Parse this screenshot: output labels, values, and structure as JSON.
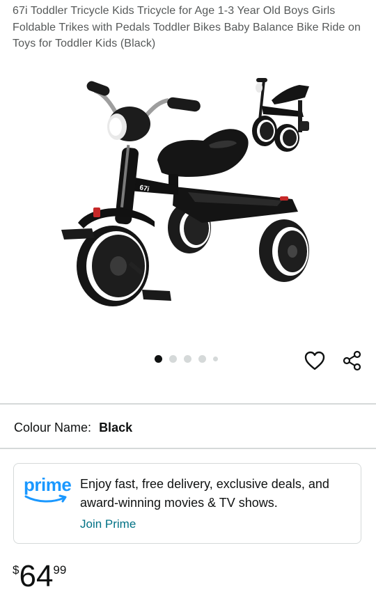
{
  "product": {
    "title": "67i Toddler Tricycle Kids Tricycle for Age 1-3 Year Old Boys Girls Foldable Trikes with Pedals Toddler Bikes Baby Balance Bike Ride on Toys for Toddler Kids (Black)",
    "image_brand_mark": "67i"
  },
  "gallery": {
    "count": 5,
    "active_index": 0
  },
  "colour": {
    "label": "Colour Name:",
    "value": "Black"
  },
  "prime": {
    "logo_text": "prime",
    "text": "Enjoy fast, free delivery, exclusive deals, and award-winning movies & TV shows.",
    "link": "Join Prime",
    "brand_color": "#1a98ff",
    "link_color": "#007185"
  },
  "price": {
    "symbol": "$",
    "whole": "64",
    "fraction": "99"
  },
  "icons": {
    "wishlist": "heart-icon",
    "share": "share-icon"
  }
}
